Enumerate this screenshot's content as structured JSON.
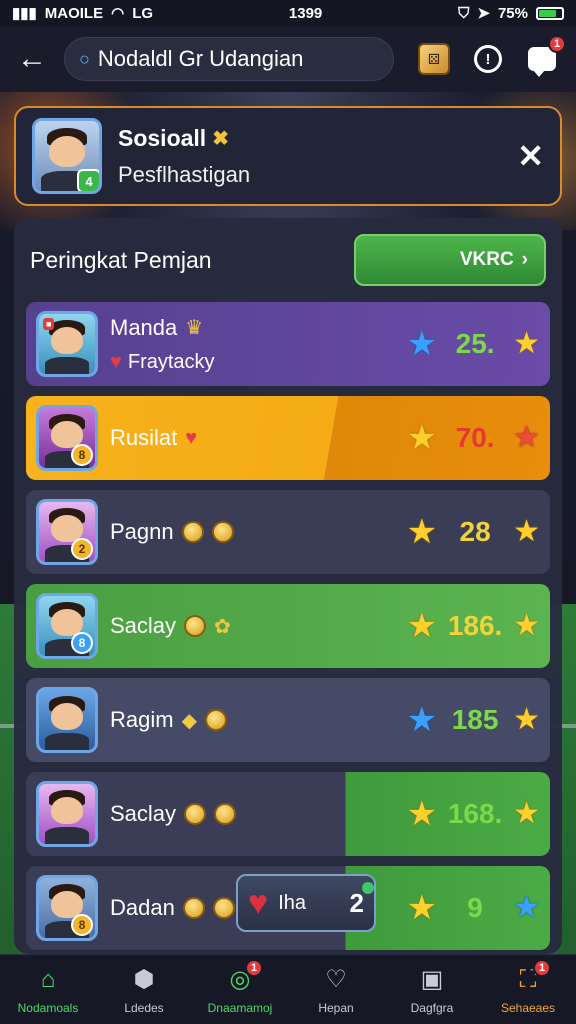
{
  "status_bar": {
    "carrier": "MAOILE",
    "network": "LG",
    "time": "1399",
    "battery": "75%"
  },
  "header": {
    "search_value": "Nodaldl Gr Udangian",
    "chat_badge": "1"
  },
  "notification": {
    "title": "Sosioall",
    "subtitle": "Pesflhastigan",
    "avatar_badge": "4"
  },
  "leaderboard": {
    "title": "Peringkat Pemjan",
    "action_label": "VKRC",
    "rows": [
      {
        "name": "Manda",
        "sub": "Fraytacky",
        "score": "25.",
        "rank": ""
      },
      {
        "name": "Rusilat",
        "sub": "",
        "score": "70.",
        "rank": "8"
      },
      {
        "name": "Pagnn",
        "sub": "",
        "score": "28",
        "rank": "2"
      },
      {
        "name": "Saclay",
        "sub": "",
        "score": "186.",
        "rank": "8"
      },
      {
        "name": "Ragim",
        "sub": "",
        "score": "185",
        "rank": ""
      },
      {
        "name": "Saclay",
        "sub": "",
        "score": "168.",
        "rank": ""
      },
      {
        "name": "Dadan",
        "sub": "",
        "score": "9",
        "rank": "8"
      }
    ],
    "popup": {
      "label": "Iha",
      "value": "2"
    }
  },
  "bottom_nav": {
    "items": [
      {
        "label": "Nodamoals"
      },
      {
        "label": "Ldedes"
      },
      {
        "label": "Dnaamamoj",
        "badge": "1"
      },
      {
        "label": "Hepan"
      },
      {
        "label": "Dagfgra"
      },
      {
        "label": "Sehaeaes",
        "badge": "1"
      }
    ]
  },
  "colors": {
    "accent_green": "#4cd964",
    "notif_border": "#d98a2a",
    "badge_red": "#e53a3a"
  }
}
